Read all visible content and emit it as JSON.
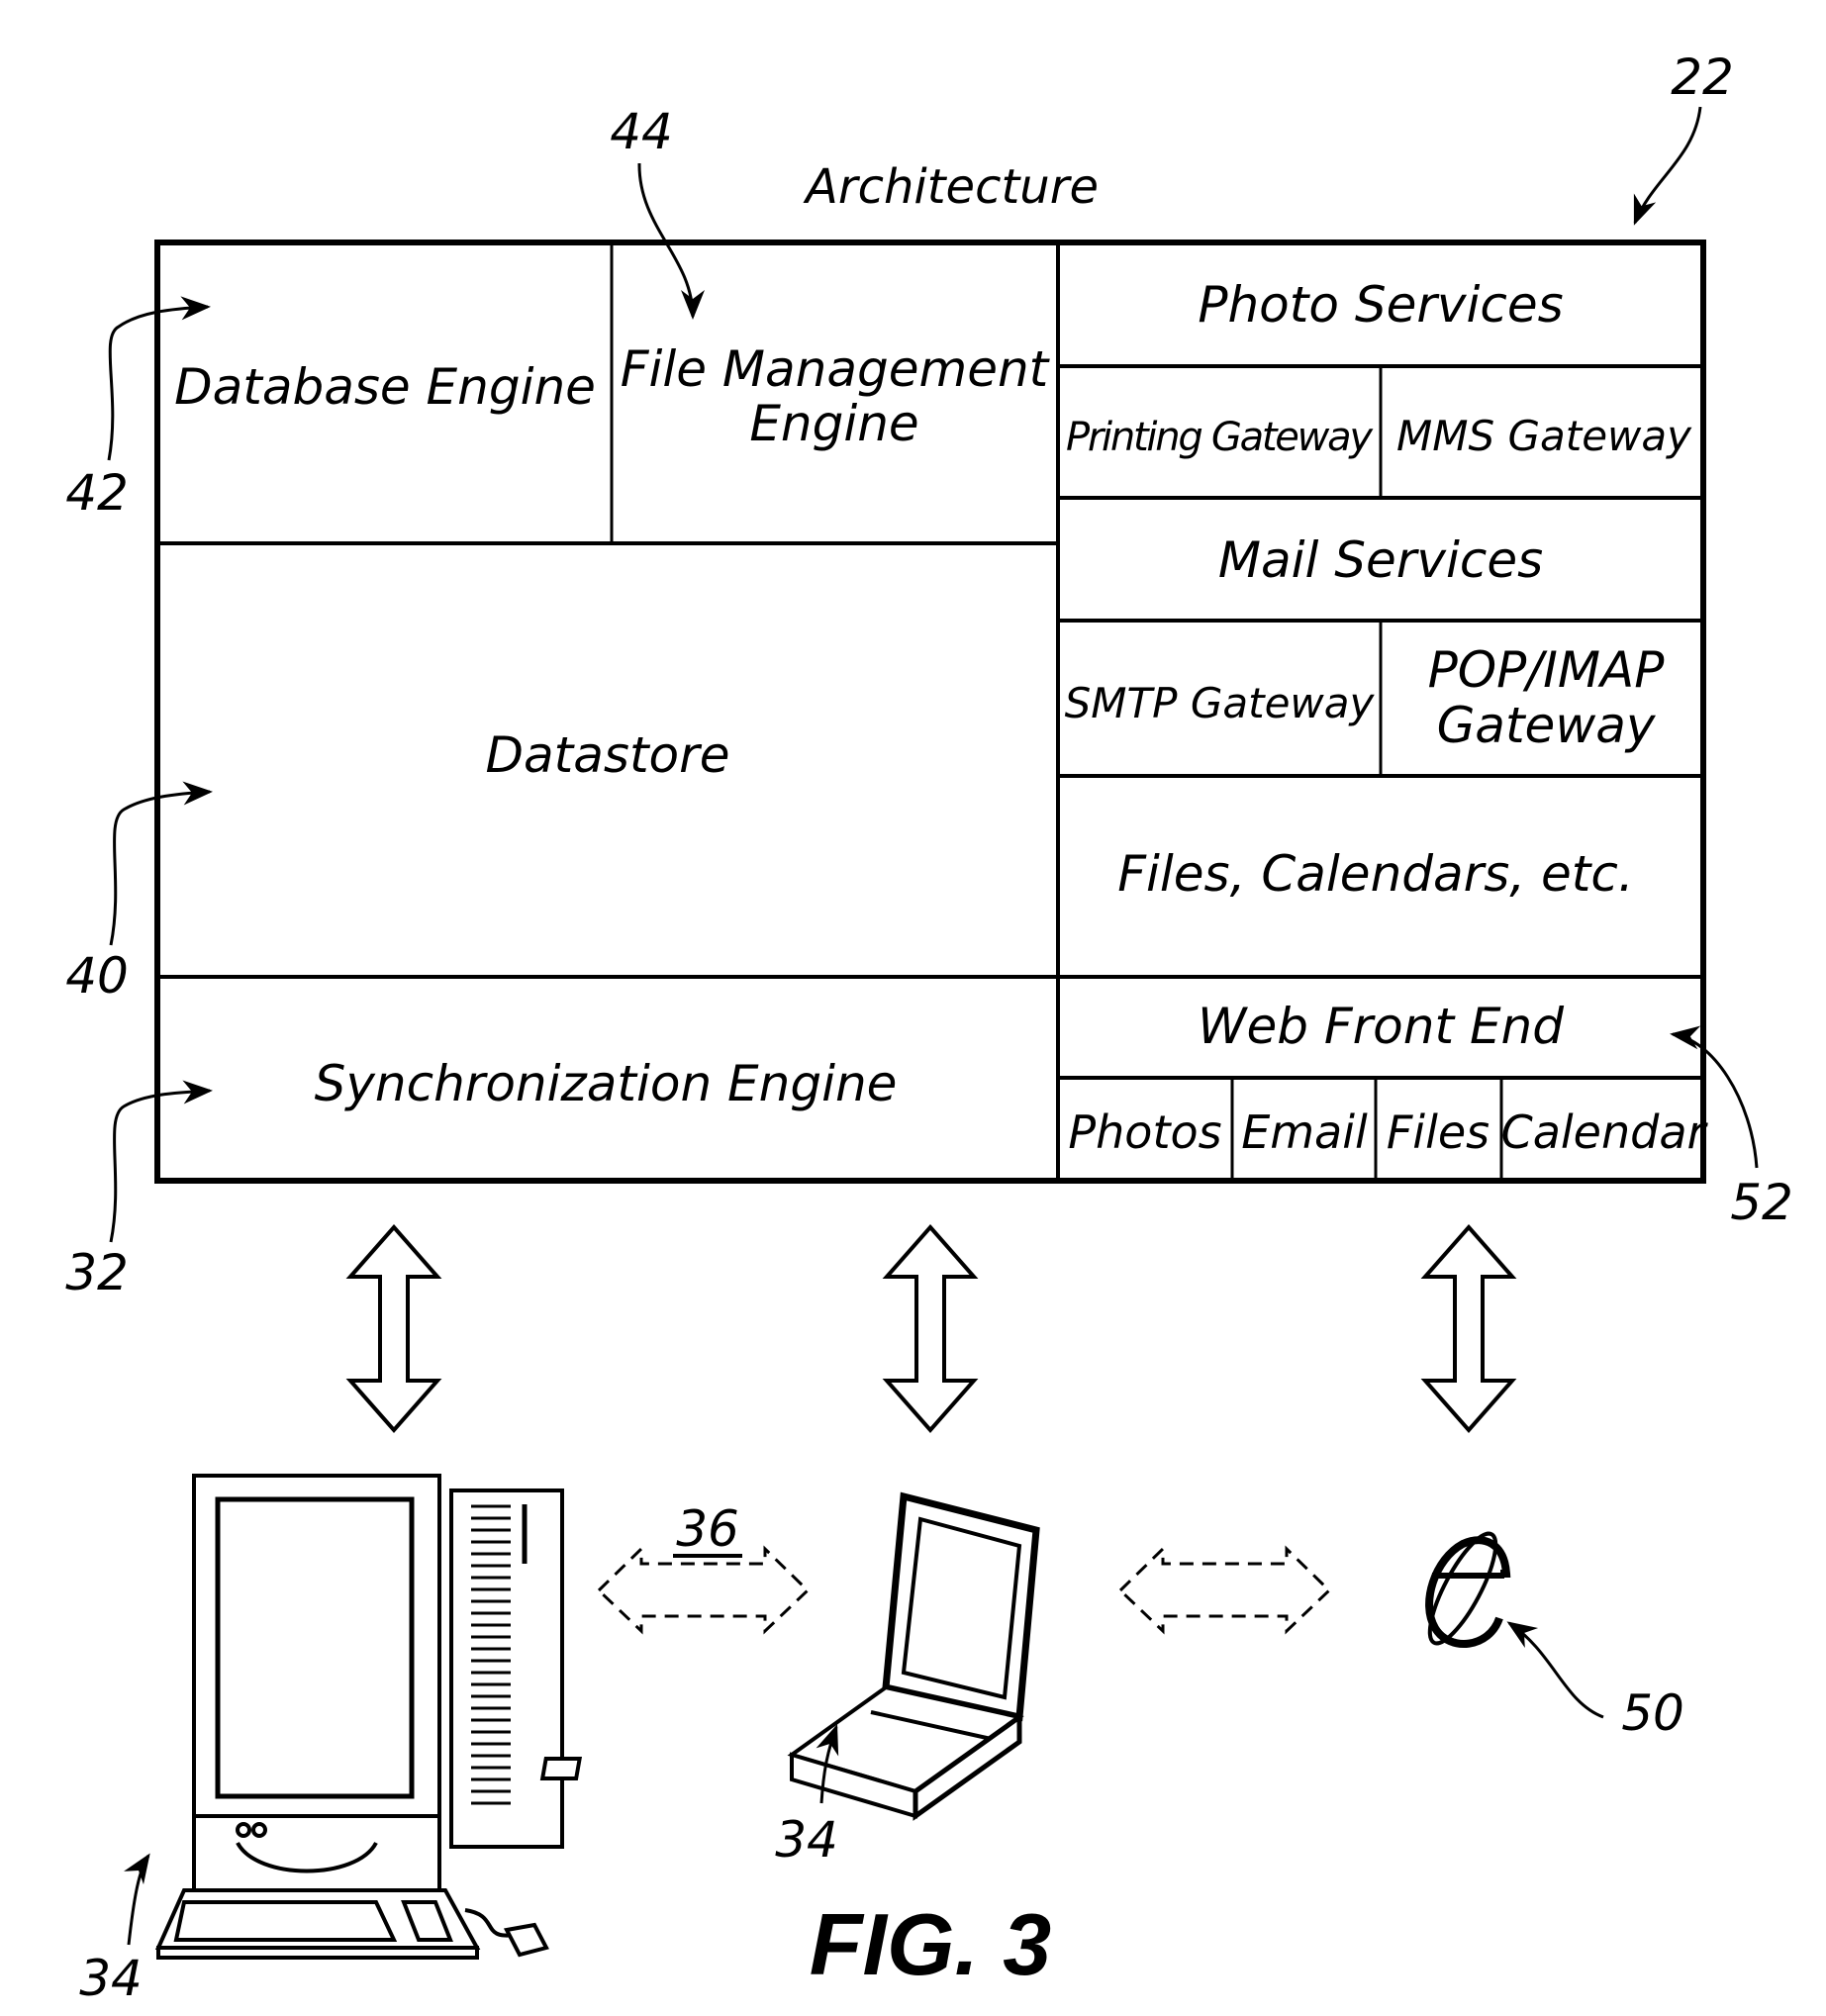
{
  "title": "Architecture",
  "figure_label": "FIG. 3",
  "reference_numerals": {
    "architecture": "22",
    "file_management_engine": "44",
    "database_engine": "42",
    "datastore": "40",
    "synchronization_engine": "32",
    "web_front_end": "52",
    "desktop_client": "34",
    "laptop_client": "34",
    "peer_link": "36",
    "web_browser": "50"
  },
  "left_blocks": {
    "database_engine": "Database Engine",
    "file_management_engine_line1": "File Management",
    "file_management_engine_line2": "Engine",
    "datastore": "Datastore",
    "synchronization_engine": "Synchronization Engine"
  },
  "right_blocks": {
    "photo_services": "Photo Services",
    "printing_gateway": "Printing Gateway",
    "mms_gateway": "MMS Gateway",
    "mail_services": "Mail Services",
    "smtp_gateway": "SMTP Gateway",
    "pop_imap_line1": "POP/IMAP",
    "pop_imap_line2": "Gateway",
    "files_calendars": "Files, Calendars, etc.",
    "web_front_end": "Web Front End",
    "web_tabs": [
      "Photos",
      "Email",
      "Files",
      "Calendar"
    ]
  },
  "devices": {
    "desktop": "desktop-computer",
    "laptop": "laptop-computer",
    "browser": "web-browser-e-logo"
  }
}
